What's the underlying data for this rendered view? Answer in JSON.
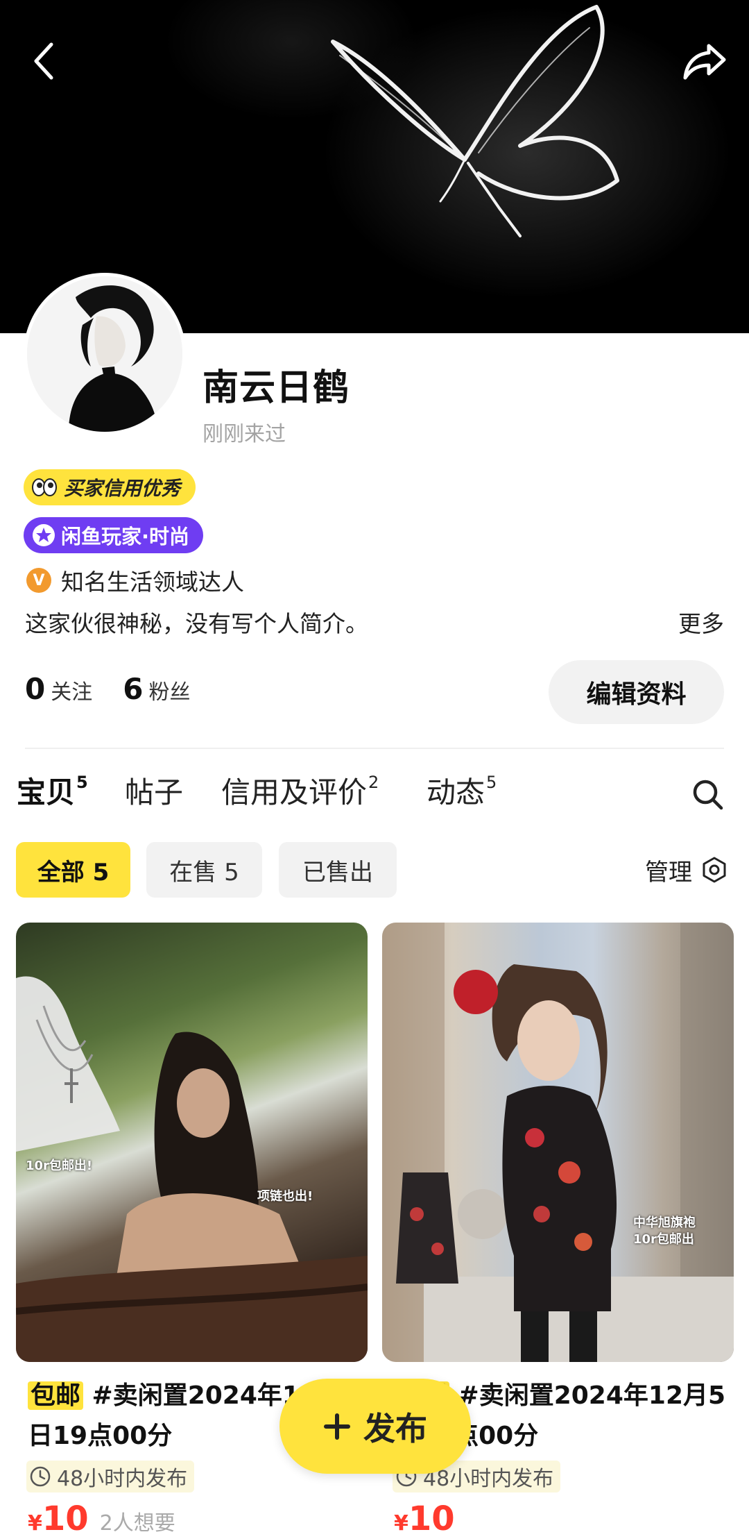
{
  "profile": {
    "name": "南云日鹤",
    "last_seen": "刚刚来过",
    "credit_badge": "买家信用优秀",
    "player_badge": "闲鱼玩家·时尚",
    "expert_mark": "V",
    "expert_title": "知名生活领域达人",
    "bio": "这家伙很神秘，没有写个人简介。",
    "more_label": "更多",
    "following_count": "0",
    "following_label": "关注",
    "followers_count": "6",
    "followers_label": "粉丝",
    "edit_button": "编辑资料"
  },
  "tabs": [
    {
      "label": "宝贝",
      "count": "5",
      "active": true
    },
    {
      "label": "帖子",
      "count": ""
    },
    {
      "label": "信用及评价",
      "count": "2"
    },
    {
      "label": "动态",
      "count": "5"
    }
  ],
  "filters": {
    "all": "全部 5",
    "on_sale": "在售 5",
    "sold": "已售出",
    "manage": "管理"
  },
  "products": [
    {
      "tag": "包邮",
      "title": " #卖闲置2024年12月5日19点00分",
      "time_note": "48小时内发布",
      "currency": "¥",
      "price": "10",
      "wants": "2人想要",
      "image_caption_1": "10r包邮出!",
      "image_caption_2": "项链也出!"
    },
    {
      "tag": "包邮",
      "title": " #卖闲置2024年12月5日19点00分",
      "time_note": "48小时内发布",
      "currency": "¥",
      "price": "10",
      "wants": "",
      "image_caption_1": "中华旭旗袍",
      "image_caption_2": "10r包邮出"
    }
  ],
  "fab": {
    "label": "发布"
  },
  "colors": {
    "accent": "#ffe33d",
    "price": "#ff3a2d",
    "player_badge": "#6f3df2",
    "expert": "#f29a2e"
  }
}
